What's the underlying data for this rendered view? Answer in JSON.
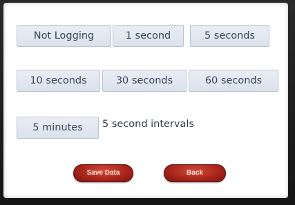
{
  "options": {
    "row1": [
      "Not Logging",
      "1 second",
      "5 seconds"
    ],
    "row2": [
      "10 seconds",
      "30 seconds",
      "60 seconds"
    ],
    "row3": [
      "5 minutes"
    ]
  },
  "status_text": "5 second intervals",
  "buttons": {
    "save_label": "Save Data",
    "back_label": "Back"
  },
  "colors": {
    "option_background": "#e2e8f0",
    "option_border": "#b9c3d1",
    "option_text": "#39465a",
    "action_button": "#a9261d",
    "action_text": "#f4e8d8"
  }
}
